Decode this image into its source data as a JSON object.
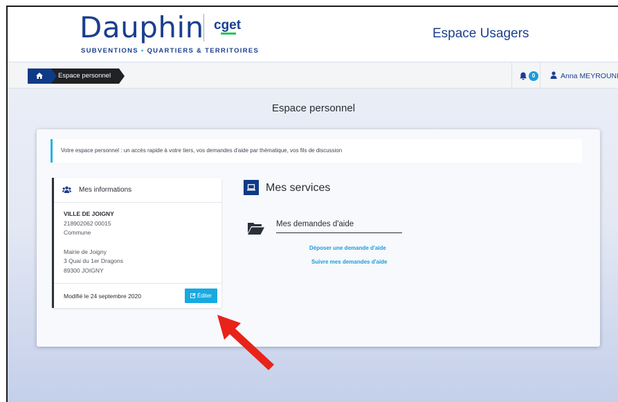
{
  "header": {
    "logo_brand": "Dauphin",
    "logo_partner": "cget",
    "tagline_part1": "SUBVENTIONS",
    "tagline_part2": "QUARTIERS & TERRITOIRES",
    "tagline_dot": "•",
    "portal_title": "Espace Usagers"
  },
  "breadcrumb": {
    "home_icon": "home-icon",
    "current": "Espace personnel"
  },
  "notifications": {
    "icon": "bell-icon",
    "count": "0"
  },
  "user": {
    "icon": "user-icon",
    "name": "Anna MEYROUNI"
  },
  "page": {
    "title": "Espace personnel"
  },
  "intro": {
    "text": "Votre espace personnel : un accès rapide à votre tiers, vos demandes d'aide par thématique, vos fils de discussion"
  },
  "info_panel": {
    "icon": "users-icon",
    "title": "Mes informations",
    "org_name": "VILLE DE JOIGNY",
    "siret": "218902062 00015",
    "type": "Commune",
    "address_line1": "Mairie de Joigny",
    "address_line2": "3 Quai du 1er Dragons",
    "address_line3": "89300 JOIGNY",
    "modified": "Modifié le 24 septembre 2020",
    "edit_label": "Éditer"
  },
  "services": {
    "icon": "laptop-icon",
    "title": "Mes services",
    "demandes": {
      "icon": "folder-open-icon",
      "title": "Mes demandes d'aide",
      "link_deposit": "Déposer une demande d'aide",
      "link_follow": "Suivre mes demandes d'aide"
    }
  },
  "annotation": {
    "arrow_color": "#e8231a"
  },
  "colors": {
    "brand_navy": "#1b3f8f",
    "accent_blue": "#19a9e1",
    "dark_crumb": "#1f2125"
  }
}
